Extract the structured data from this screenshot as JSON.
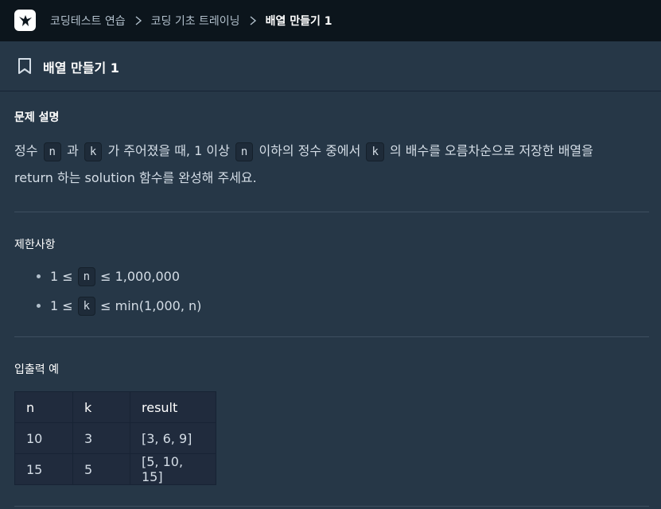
{
  "breadcrumb": {
    "items": [
      "코딩테스트 연습",
      "코딩 기초 트레이닝"
    ],
    "current": "배열 만들기 1"
  },
  "page": {
    "title": "배열 만들기 1"
  },
  "problem": {
    "heading": "문제 설명",
    "line1": {
      "t1": "정수",
      "c1": "n",
      "t2": "과",
      "c2": "k",
      "t3": "가 주어졌을 때, 1 이상",
      "c3": "n",
      "t4": "이하의 정수 중에서",
      "c4": "k",
      "t5": "의 배수를 오름차순으로 저장한 배열을"
    },
    "line2": "return 하는 solution 함수를 완성해 주세요."
  },
  "constraints": {
    "heading": "제한사항",
    "items": [
      {
        "pre": "1 ≤",
        "code": "n",
        "post": "≤ 1,000,000"
      },
      {
        "pre": "1 ≤",
        "code": "k",
        "post": "≤ min(1,000, n)"
      }
    ]
  },
  "examples": {
    "heading": "입출력 예",
    "columns": [
      "n",
      "k",
      "result"
    ],
    "rows": [
      [
        "10",
        "3",
        "[3, 6, 9]"
      ],
      [
        "15",
        "5",
        "[5, 10, 15]"
      ]
    ]
  }
}
